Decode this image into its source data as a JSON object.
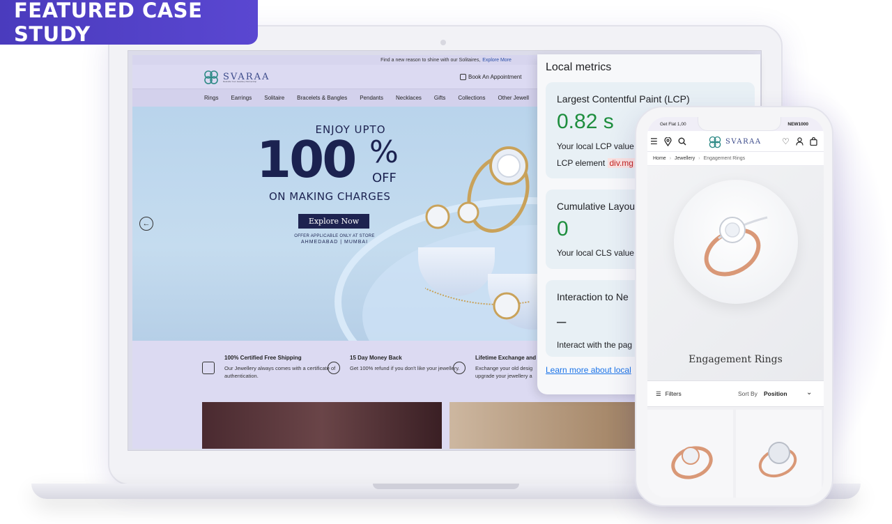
{
  "badge": {
    "label": "FEATURED CASE STUDY"
  },
  "site": {
    "promo_text": "Find a new reason to shine with our Solitaires,",
    "promo_link": "Explore More",
    "brand": "SVARAA",
    "tagline": "Rekindle Your Jewellery Partnership",
    "book_appointment": "Book An Appointment",
    "nav": [
      "Rings",
      "Earrings",
      "Solitaire",
      "Bracelets & Bangles",
      "Pendants",
      "Necklaces",
      "Gifts",
      "Collections",
      "Other Jewell"
    ],
    "hero": {
      "enjoy": "ENJOY UPTO",
      "big": "100",
      "percent": "%",
      "off": "OFF",
      "making": "ON MAKING CHARGES",
      "cta": "Explore Now",
      "offer_note": "OFFER APPLICABLE ONLY AT STORE",
      "cities": "AHMEDABAD | MUMBAI"
    },
    "usps": [
      {
        "title": "100% Certified Free Shipping",
        "desc": "Our Jewellery always comes with a certificate of authentication."
      },
      {
        "title": "15 Day Money Back",
        "desc": "Get 100% refund if you don't like your jewellery."
      },
      {
        "title": "Lifetime Exchange and",
        "desc": "Exchange your old desig upgrade your jewellery a"
      }
    ]
  },
  "metrics": {
    "title": "Local metrics",
    "lcp": {
      "title": "Largest Contentful Paint (LCP)",
      "value": "0.82 s",
      "desc": "Your local LCP value",
      "element_label": "LCP element",
      "element": "div.mg"
    },
    "cls": {
      "title": "Cumulative Layout",
      "value": "0",
      "desc": "Your local CLS value"
    },
    "inp": {
      "title": "Interaction to Ne",
      "value": "–",
      "desc": "Interact with the pag"
    },
    "learn_more": "Learn more about local"
  },
  "phone": {
    "promo_left": "Get Flat 1,00",
    "promo_right": "NEW1000",
    "brand": "SVARAA",
    "breadcrumb": [
      "Home",
      "Jewellery",
      "Engagement Rings"
    ],
    "category_title": "Engagement Rings",
    "filters": "Filters",
    "sort_by": "Sort By",
    "sort_value": "Position"
  }
}
